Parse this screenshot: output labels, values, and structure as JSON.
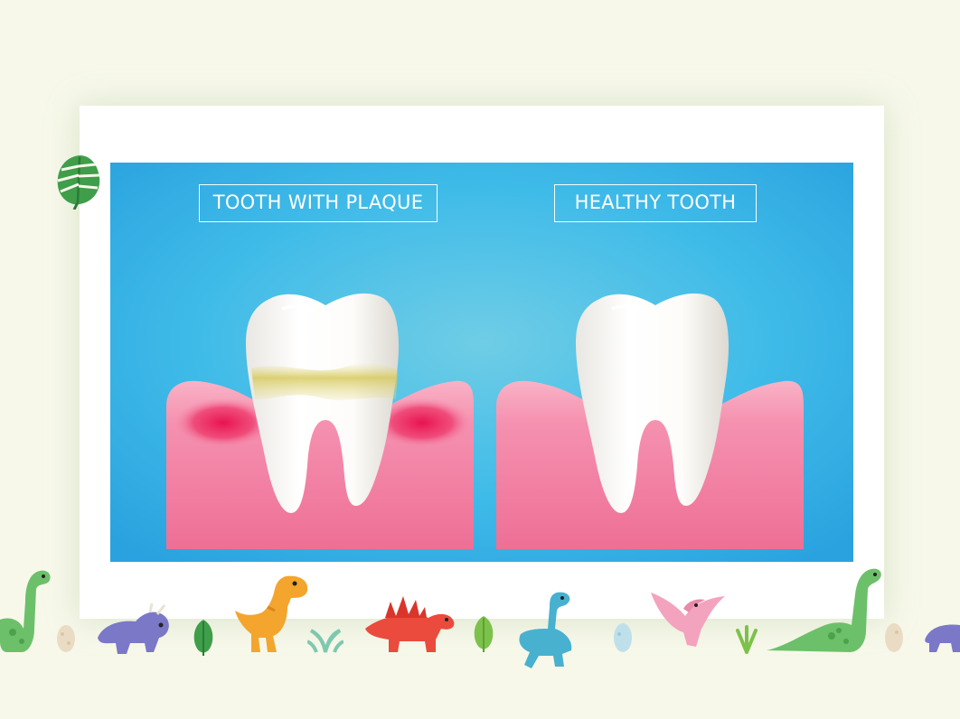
{
  "slide": {
    "labels": {
      "plaque": "TOOTH WITH PLAQUE",
      "healthy": "HEALTHY TOOTH"
    }
  },
  "colors": {
    "page_background": "#f7f8ea",
    "panel_blue": "#35b7ea",
    "gum_pink": "#f27aa0",
    "gum_inflamed": "#ea1f5e",
    "plaque_yellow": "#d8cc6a",
    "tooth_white": "#ffffff"
  },
  "decorations": [
    "monstera-leaf-icon",
    "brachiosaurus-icon",
    "dino-egg-icon",
    "triceratops-icon",
    "trex-icon",
    "stegosaurus-icon",
    "plesiosaur-icon",
    "pterodactyl-icon",
    "grass-tuft-icon"
  ]
}
